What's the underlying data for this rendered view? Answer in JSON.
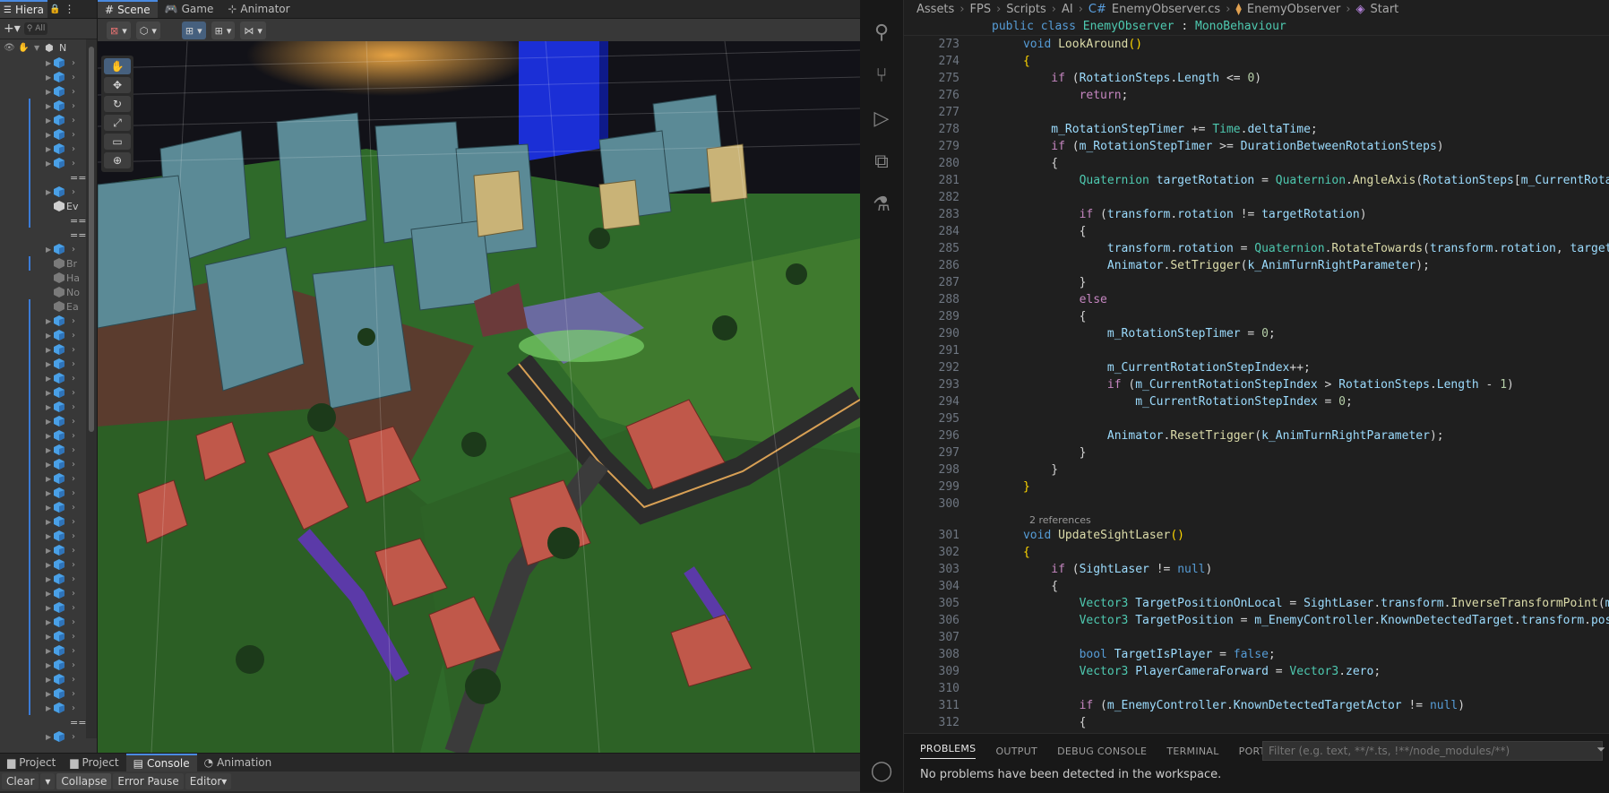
{
  "unity": {
    "hierarchy": {
      "tab_label": "Hiera",
      "search_placeholder": "All",
      "root_label": "N",
      "partial_labels": {
        "ev": "Ev",
        "br": "Br",
        "ha": "Ha",
        "no": "No",
        "ea": "Ea",
        "eq1": "==",
        "eq2": "==",
        "eq3": "==",
        "eq4": "=="
      }
    },
    "scene_tabs": [
      {
        "label": "Scene",
        "icon": "grid-icon"
      },
      {
        "label": "Game",
        "icon": "gamepad-icon"
      },
      {
        "label": "Animator",
        "icon": "animator-icon"
      }
    ],
    "tools": [
      "hand-tool",
      "move-tool",
      "rotate-tool",
      "scale-tool",
      "rect-tool",
      "transform-tool"
    ],
    "bottom_tabs": [
      {
        "label": "Project",
        "icon": "folder-icon"
      },
      {
        "label": "Project",
        "icon": "folder-icon"
      },
      {
        "label": "Console",
        "icon": "console-icon"
      },
      {
        "label": "Animation",
        "icon": "animation-icon"
      }
    ],
    "console_toolbar": {
      "clear": "Clear",
      "collapse": "Collapse",
      "error_pause": "Error Pause",
      "editor": "Editor"
    }
  },
  "vscode": {
    "breadcrumbs": [
      "Assets",
      "FPS",
      "Scripts",
      "AI",
      "EnemyObserver.cs",
      "EnemyObserver",
      "Start"
    ],
    "sticky_line": "public class EnemyObserver : MonoBehaviour",
    "code_lens": "2 references",
    "lines": {
      "n273": "273",
      "n274": "274",
      "n275": "275",
      "n276": "276",
      "n277": "277",
      "n278": "278",
      "n279": "279",
      "n280": "280",
      "n281": "281",
      "n282": "282",
      "n283": "283",
      "n284": "284",
      "n285": "285",
      "n286": "286",
      "n287": "287",
      "n288": "288",
      "n289": "289",
      "n290": "290",
      "n291": "291",
      "n292": "292",
      "n293": "293",
      "n294": "294",
      "n295": "295",
      "n296": "296",
      "n297": "297",
      "n298": "298",
      "n299": "299",
      "n300": "300",
      "n301": "301",
      "n302": "302",
      "n303": "303",
      "n304": "304",
      "n305": "305",
      "n306": "306",
      "n307": "307",
      "n308": "308",
      "n309": "309",
      "n310": "310",
      "n311": "311",
      "n312": "312"
    },
    "panel": {
      "tabs": [
        "PROBLEMS",
        "OUTPUT",
        "DEBUG CONSOLE",
        "TERMINAL",
        "PORTS"
      ],
      "filter_placeholder": "Filter (e.g. text, **/*.ts, !**/node_modules/**)",
      "message": "No problems have been detected in the workspace."
    }
  }
}
